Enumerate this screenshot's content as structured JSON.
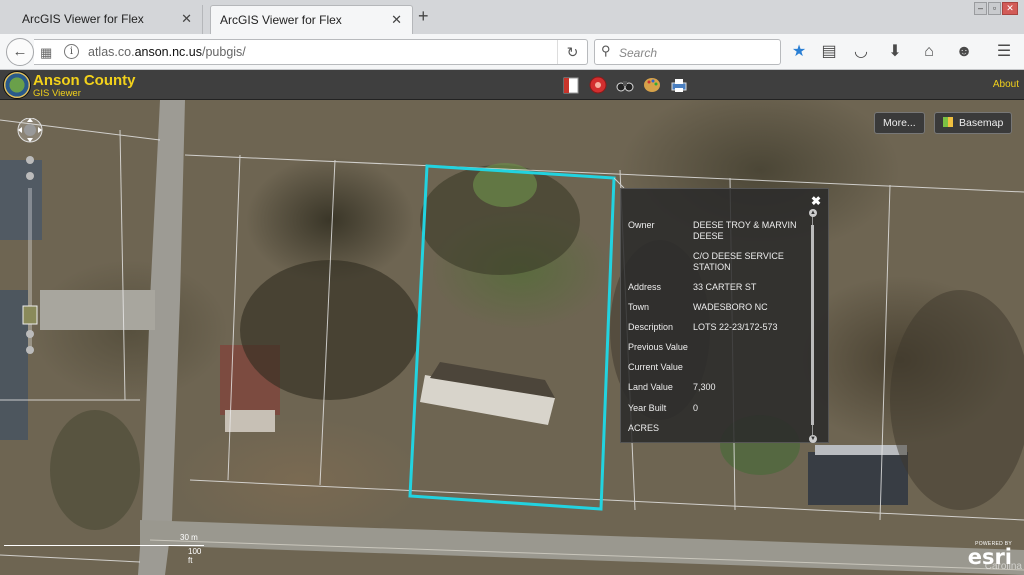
{
  "browser": {
    "tabs": [
      {
        "title": "ArcGIS Viewer for Flex",
        "active": false
      },
      {
        "title": "ArcGIS Viewer for Flex",
        "active": true
      }
    ],
    "url_prefix": "atlas.co.",
    "url_domain": "anson.nc.us",
    "url_path": "/pubgis/",
    "search_placeholder": "Search"
  },
  "app": {
    "title": "Anson County",
    "subtitle": "GIS Viewer",
    "about_label": "About",
    "tools": [
      {
        "name": "bookmark-tool-icon",
        "color": "#c8352b"
      },
      {
        "name": "search-tool-icon",
        "color": "#d32f2f"
      },
      {
        "name": "binoculars-tool-icon",
        "color": "#3a3a3a"
      },
      {
        "name": "palette-tool-icon",
        "color": "#d7a24a"
      },
      {
        "name": "print-tool-icon",
        "color": "#4a7fc0"
      }
    ]
  },
  "map": {
    "more_label": "More...",
    "basemap_label": "Basemap",
    "selection_color": "#22d3e0",
    "scale_metric": "30 m",
    "scale_imperial": "100 ft",
    "powered_by": "POWERED BY",
    "esri_logo": "esri",
    "watermark": "Carolina"
  },
  "popup": {
    "close_label": "✖",
    "rows": [
      {
        "key": "Owner",
        "value": "DEESE TROY & MARVIN DEESE"
      },
      {
        "key": "",
        "value": "C/O DEESE SERVICE STATION"
      },
      {
        "key": "Address",
        "value": "33 CARTER ST"
      },
      {
        "key": "Town",
        "value": "WADESBORO  NC"
      },
      {
        "key": "Description",
        "value": "LOTS 22-23/172-573"
      },
      {
        "key": "Previous Value",
        "value": ""
      },
      {
        "key": "Current Value",
        "value": ""
      },
      {
        "key": "Land Value",
        "value": "7,300"
      },
      {
        "key": "Year Built",
        "value": "0"
      },
      {
        "key": "ACRES",
        "value": ""
      }
    ]
  }
}
